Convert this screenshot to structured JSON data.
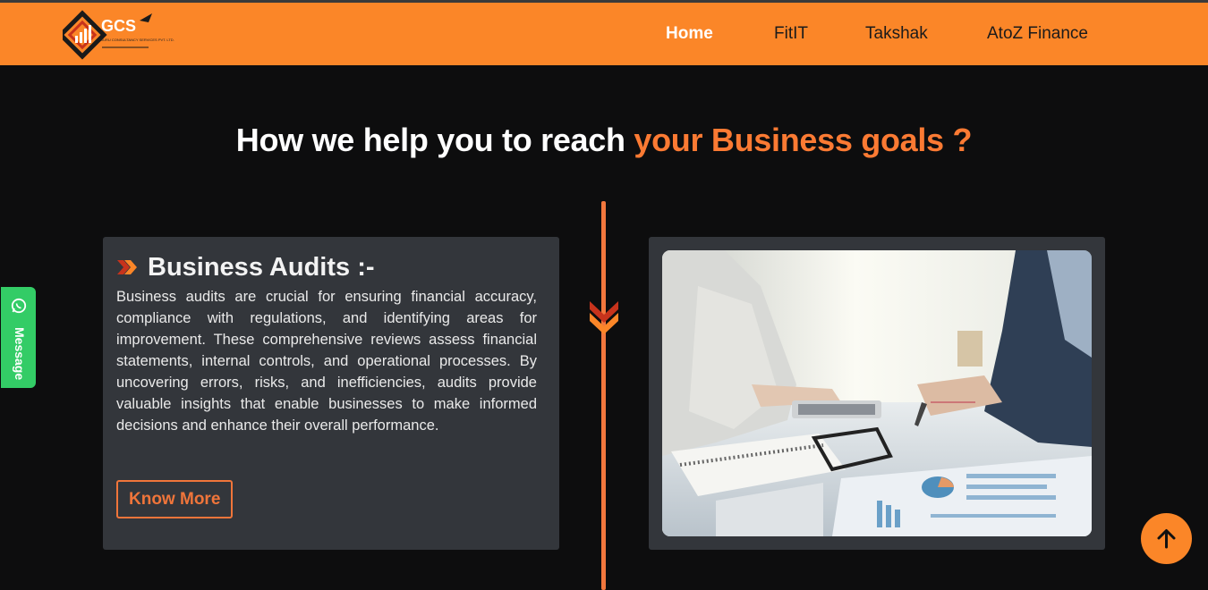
{
  "header": {
    "logo_text": "GCS",
    "logo_tagline": "GURU CONSULTANCY SERVICES PVT. LTD.",
    "nav": [
      {
        "label": "Home",
        "active": true
      },
      {
        "label": "FitIT",
        "active": false
      },
      {
        "label": "Takshak",
        "active": false
      },
      {
        "label": "AtoZ Finance",
        "active": false
      }
    ]
  },
  "section": {
    "title_main": "How we help you to reach ",
    "title_accent": "your Business goals ?"
  },
  "card": {
    "title": "Business Audits :-",
    "body": "Business audits are crucial for ensuring financial accuracy, compliance with regulations, and identifying areas for improvement. These comprehensive reviews assess financial statements, internal controls, and operational processes. By uncovering errors, risks, and inefficiencies, audits provide valuable insights that enable businesses to make informed decisions and enhance their overall performance.",
    "button_label": "Know More"
  },
  "floating": {
    "message_label": "Message",
    "scroll_top_icon": "arrow-up-icon",
    "message_icon": "whatsapp-icon"
  },
  "colors": {
    "brand_orange": "#fb8628",
    "accent": "#fb7a33",
    "timeline": "#f2773d",
    "card_bg": "#33363b",
    "page_bg": "#0d0d0e",
    "message_green": "#33cc66"
  }
}
